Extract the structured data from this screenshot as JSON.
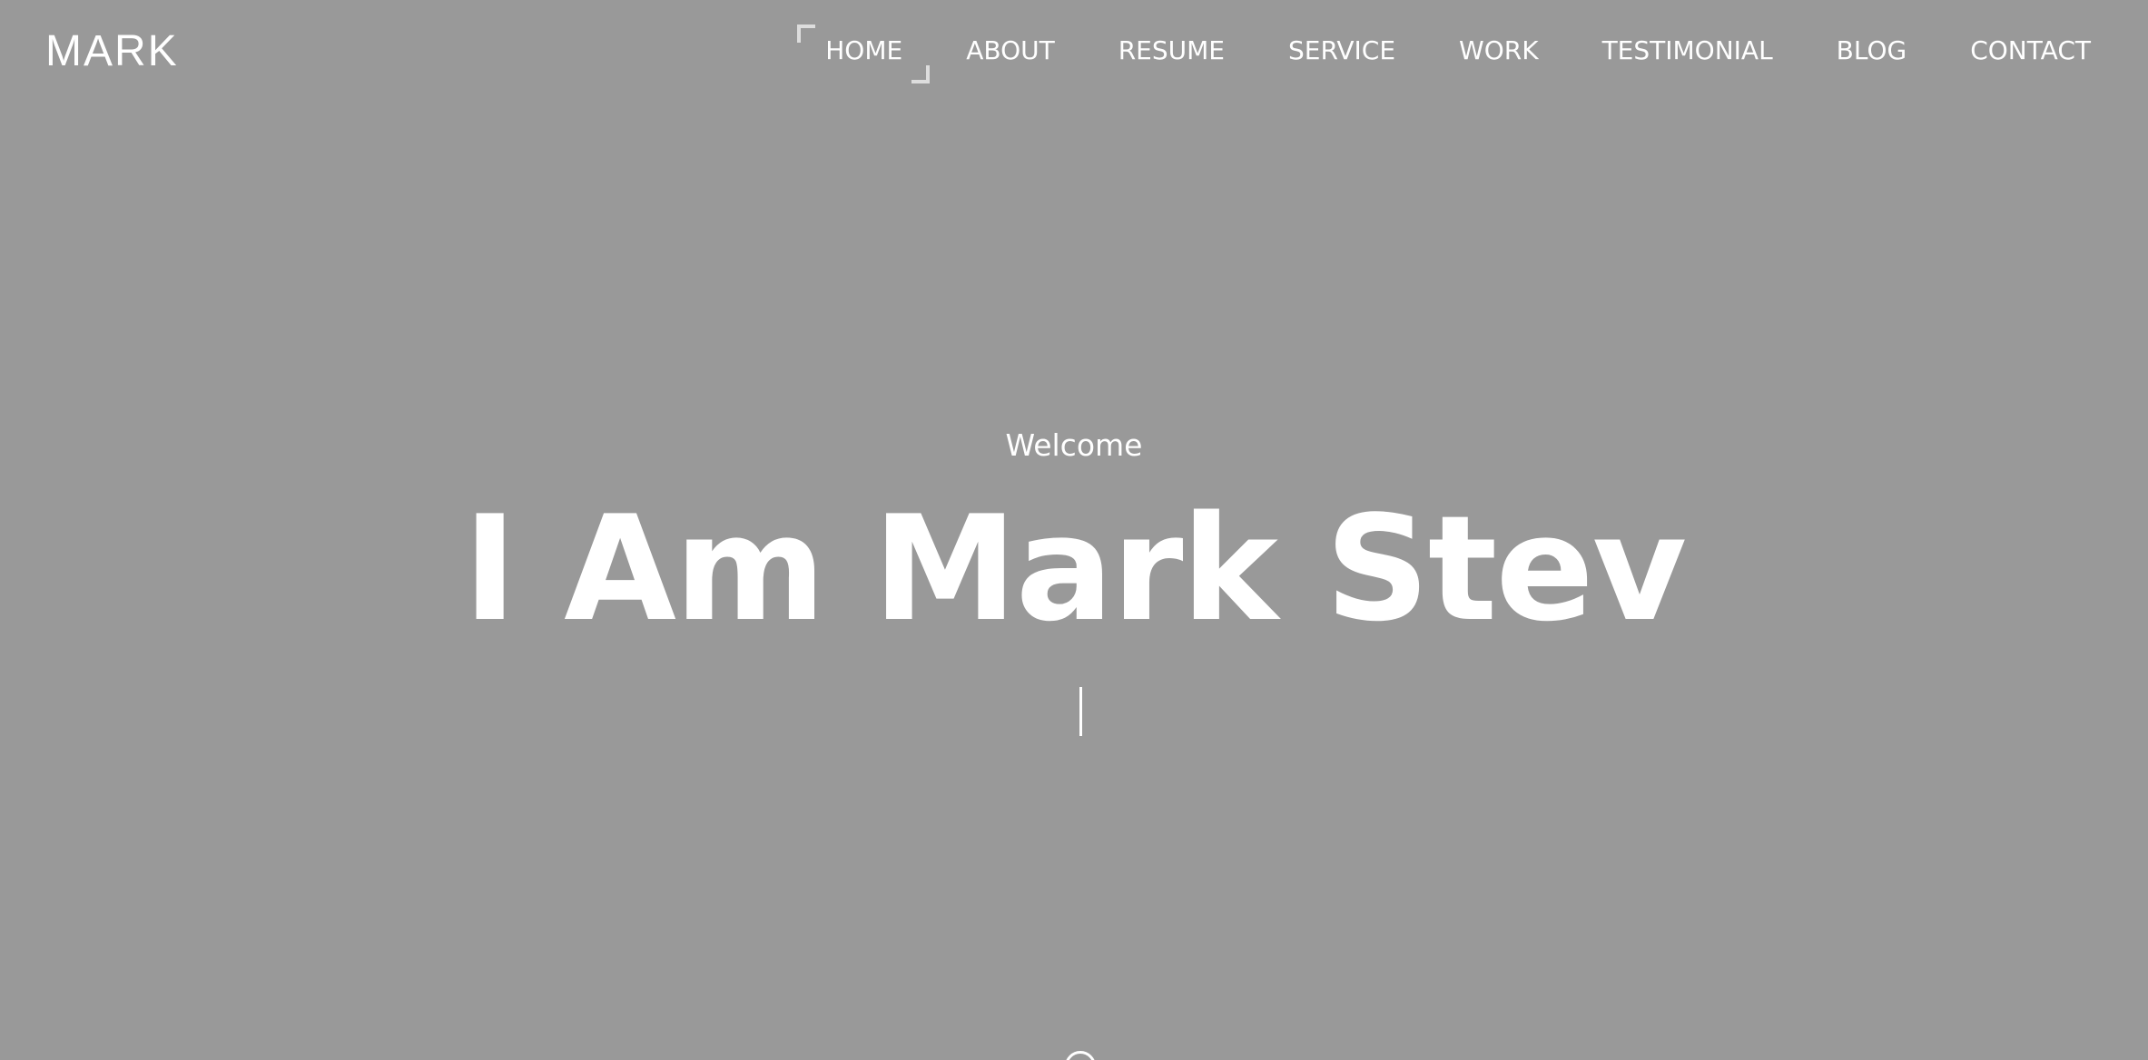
{
  "header": {
    "logo": "MARK",
    "nav": [
      {
        "label": "HOME",
        "active": true
      },
      {
        "label": "ABOUT",
        "active": false
      },
      {
        "label": "RESUME",
        "active": false
      },
      {
        "label": "SERVICE",
        "active": false
      },
      {
        "label": "WORK",
        "active": false
      },
      {
        "label": "TESTIMONIAL",
        "active": false
      },
      {
        "label": "BLOG",
        "active": false
      },
      {
        "label": "CONTACT",
        "active": false
      }
    ]
  },
  "hero": {
    "welcome": "Welcome",
    "headline": "I Am Mark Stev"
  },
  "colors": {
    "background": "#999999",
    "text": "#ffffff",
    "active_bracket": "#dddddd"
  },
  "icons": {
    "scroll_down": "mouse-scroll-icon"
  }
}
